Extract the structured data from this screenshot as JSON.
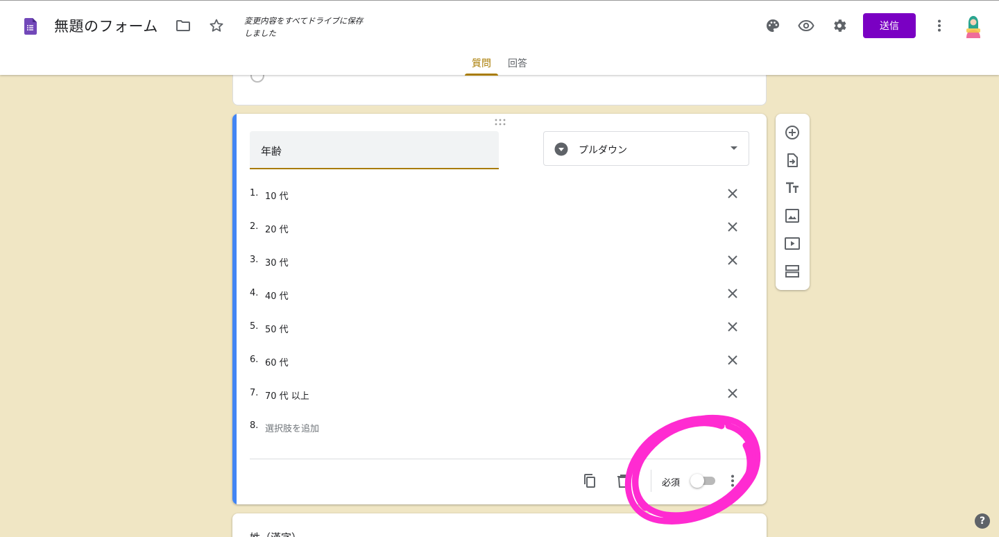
{
  "header": {
    "form_title": "無題のフォーム",
    "save_status": "変更内容をすべてドライブに保存しました",
    "send_label": "送信",
    "tabs": [
      {
        "label": "質問",
        "active": true
      },
      {
        "label": "回答",
        "active": false
      }
    ]
  },
  "question": {
    "title": "年齢",
    "type_label": "プルダウン",
    "options": [
      {
        "num": "1.",
        "text": "10 代"
      },
      {
        "num": "2.",
        "text": "20 代"
      },
      {
        "num": "3.",
        "text": "30 代"
      },
      {
        "num": "4.",
        "text": "40 代"
      },
      {
        "num": "5.",
        "text": "50 代"
      },
      {
        "num": "6.",
        "text": "60 代"
      },
      {
        "num": "7.",
        "text": "70 代 以上"
      }
    ],
    "add_option_num": "8.",
    "add_option_label": "選択肢を追加",
    "required_label": "必須",
    "required": false
  },
  "next_question": {
    "title": "姓（漢字）"
  },
  "icons": {
    "header": [
      "forms-logo-icon",
      "folder-icon",
      "star-icon",
      "palette-icon",
      "eye-icon",
      "gear-icon",
      "more-vert-icon"
    ],
    "toolbar": [
      "add-question-icon",
      "import-questions-icon",
      "add-title-icon",
      "add-image-icon",
      "add-video-icon",
      "add-section-icon"
    ],
    "question": [
      "drag-handle-icon",
      "dropdown-type-icon",
      "close-icon",
      "copy-icon",
      "trash-icon",
      "more-vert-icon"
    ],
    "help": "help-icon"
  },
  "colors": {
    "theme_background": "#f0e6c4",
    "accent": "#a87b00",
    "send_button": "#7a00c3",
    "active_card_bar": "#4285f4",
    "annotation": "#ff2bd1"
  }
}
